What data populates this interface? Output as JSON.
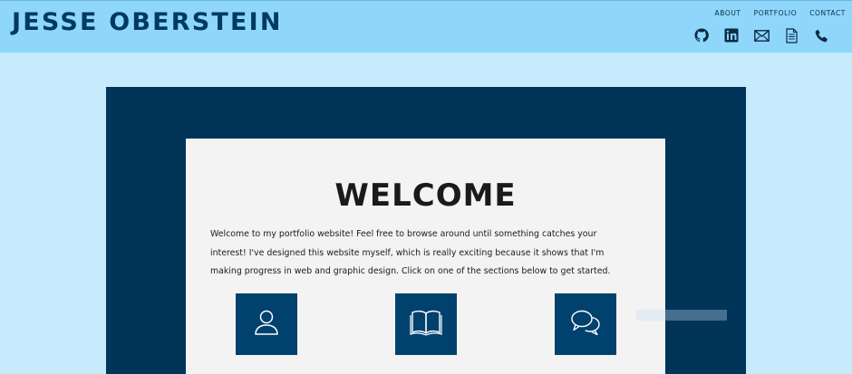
{
  "header": {
    "title": "JESSE OBERSTEIN",
    "nav": [
      {
        "label": "ABOUT"
      },
      {
        "label": "PORTFOLIO"
      },
      {
        "label": "CONTACT"
      }
    ],
    "social_icons": [
      "github-icon",
      "linkedin-icon",
      "email-icon",
      "resume-icon",
      "phone-icon"
    ]
  },
  "main": {
    "heading": "WELCOME",
    "intro": "Welcome to my portfolio website! Feel free to browse around until something catches your interest! I've designed this website myself, which is really exciting because it shows that I'm making progress in web and graphic design. Click on one of the sections below to get started.",
    "tiles": [
      {
        "icon": "user-icon"
      },
      {
        "icon": "book-icon"
      },
      {
        "icon": "chat-bubbles-icon"
      }
    ]
  },
  "colors": {
    "header_bg": "#8fd6fb",
    "page_bg": "#c5ebfd",
    "panel_bg": "#003458",
    "card_bg": "#f3f3f3",
    "tile_bg": "#00416e",
    "title_color": "#003a5e"
  }
}
